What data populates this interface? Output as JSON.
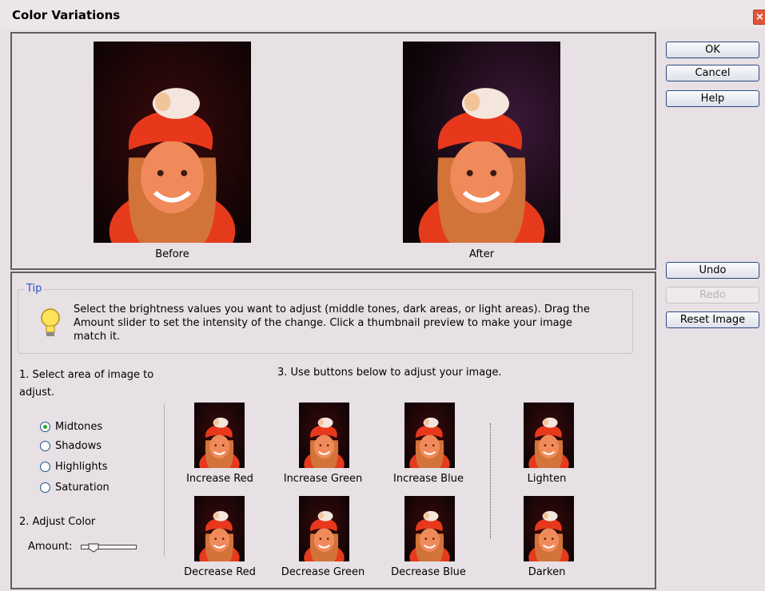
{
  "window": {
    "title": "Color Variations"
  },
  "preview": {
    "before_label": "Before",
    "after_label": "After"
  },
  "buttons": {
    "ok": "OK",
    "cancel": "Cancel",
    "help": "Help",
    "undo": "Undo",
    "redo": "Redo",
    "reset": "Reset Image"
  },
  "tip": {
    "label": "Tip",
    "text": "Select the brightness values you want to adjust (middle tones, dark areas, or light areas). Drag the Amount slider to set the intensity of the change. Click a thumbnail preview to make your image match it."
  },
  "step1": {
    "label": "1. Select area of image to adjust.",
    "options": [
      "Midtones",
      "Shadows",
      "Highlights",
      "Saturation"
    ],
    "selected": "Midtones"
  },
  "step2": {
    "label": "2. Adjust Color",
    "amount_label": "Amount:"
  },
  "step3": {
    "label": "3. Use buttons below to adjust your image.",
    "increase": [
      "Increase Red",
      "Increase Green",
      "Increase Blue"
    ],
    "decrease": [
      "Decrease Red",
      "Decrease Green",
      "Decrease Blue"
    ],
    "lighten": "Lighten",
    "darken": "Darken"
  },
  "colors": {
    "button_border": "#2b4a86",
    "tip_label": "#2a55c8",
    "radio_dot": "#2aa52a",
    "hat_red": "#e8381c"
  }
}
